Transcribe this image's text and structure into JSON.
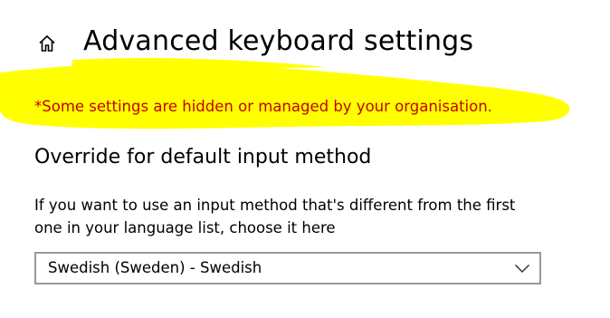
{
  "header": {
    "home_icon": "home-icon",
    "title": "Advanced keyboard settings"
  },
  "notice": {
    "text": "*Some settings are hidden or managed by your organisation.",
    "color": "#c40000",
    "highlight_color": "#ffff00"
  },
  "override_section": {
    "heading": "Override for default input method",
    "description": "If you want to use an input method that's different from the first one in your language list, choose it here",
    "dropdown": {
      "selected": "Swedish (Sweden) - Swedish",
      "icon": "chevron-down-icon"
    }
  }
}
